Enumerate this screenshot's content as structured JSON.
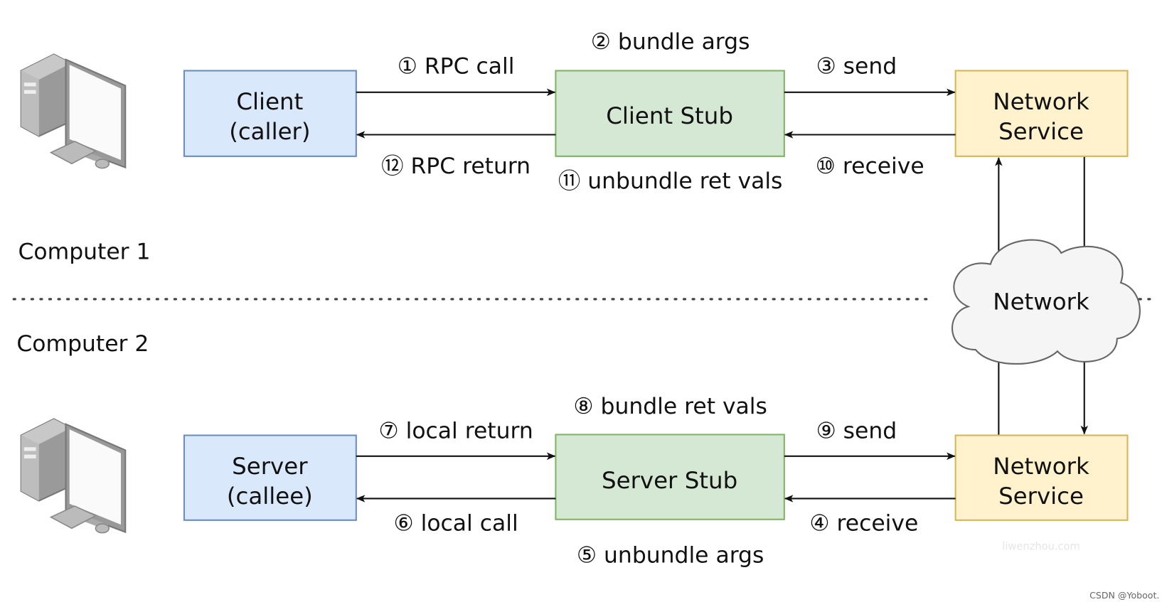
{
  "sections": {
    "computer1": "Computer 1",
    "computer2": "Computer 2"
  },
  "boxes": {
    "client": [
      "Client",
      "(caller)"
    ],
    "client_stub": "Client Stub",
    "network_service_top": [
      "Network",
      "Service"
    ],
    "server": [
      "Server",
      "(callee)"
    ],
    "server_stub": "Server Stub",
    "network_service_bottom": [
      "Network",
      "Service"
    ],
    "network": "Network"
  },
  "steps": {
    "s1": "① RPC call",
    "s2": "② bundle args",
    "s3": "③ send",
    "s4": "④ receive",
    "s5": "⑤ unbundle args",
    "s6": "⑥ local call",
    "s7": "⑦ local return",
    "s8": "⑧ bundle ret vals",
    "s9": "⑨ send",
    "s10": "⑩ receive",
    "s11": "⑪ unbundle ret vals",
    "s12": "⑫ RPC return"
  },
  "watermark": "liwenzhou.com",
  "credit": "CSDN @Yoboot.",
  "colors": {
    "client_fill": "#dae8fc",
    "client_stroke": "#6c8ebf",
    "stub_fill": "#d5e8d4",
    "stub_stroke": "#82b366",
    "service_fill": "#fff2cc",
    "service_stroke": "#d6b656",
    "cloud_fill": "#f5f5f5",
    "cloud_stroke": "#666666"
  },
  "icons": [
    "desktop-computer-icon",
    "desktop-computer-icon"
  ]
}
